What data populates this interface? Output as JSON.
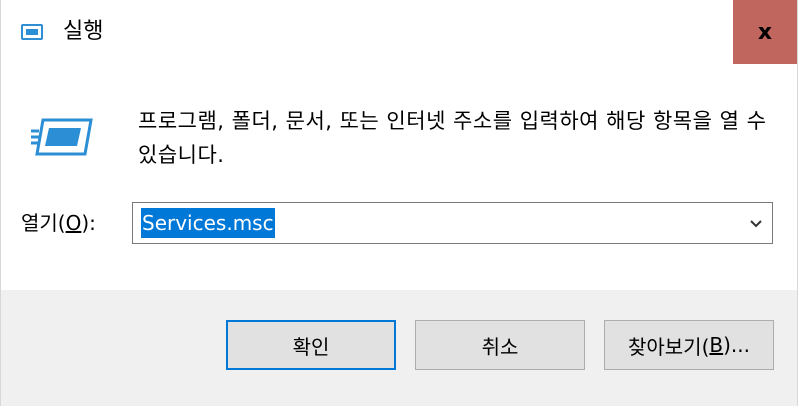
{
  "window": {
    "title": "실행",
    "close_label": "x"
  },
  "dialog": {
    "description": "프로그램, 폴더, 문서, 또는 인터넷 주소를 입력하여 해당 항목을 열 수 있습니다.",
    "open_label_prefix": "열기(",
    "open_label_mnemonic": "O",
    "open_label_suffix": "):",
    "open_value": "Services.msc"
  },
  "buttons": {
    "ok": "확인",
    "cancel": "취소",
    "browse_prefix": "찾아보기(",
    "browse_mnemonic": "B",
    "browse_suffix": ")..."
  },
  "colors": {
    "close_bg": "#c1665f",
    "selection": "#0078d7",
    "icon_blue": "#2c8fd6",
    "footer_bg": "#f0f0f0"
  },
  "icons": [
    "run-icon",
    "close-icon",
    "chevron-down-icon"
  ]
}
